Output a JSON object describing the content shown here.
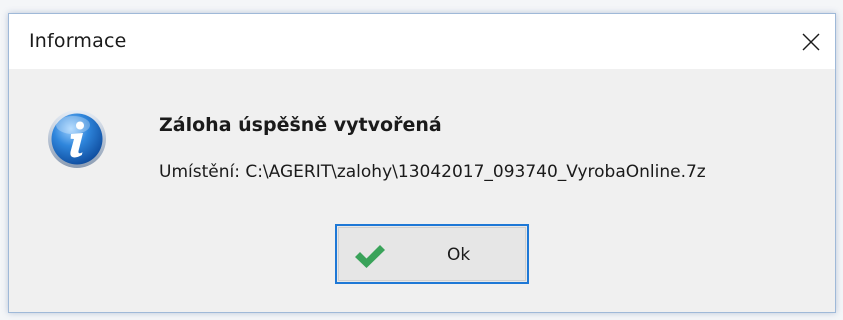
{
  "dialog": {
    "title": "Informace",
    "close_symbol": "×",
    "icon": "info-icon",
    "heading": "Záloha úspěšně vytvořená",
    "location_text": "Umístění: C:\\AGERIT\\zalohy\\13042017_093740_VyrobaOnline.7z"
  },
  "buttons": {
    "ok_label": "Ok",
    "ok_icon": "checkmark-icon"
  },
  "colors": {
    "accent_focus": "#1e78d6",
    "info_blue": "#1f6fc8",
    "check_green": "#3aa35a"
  }
}
